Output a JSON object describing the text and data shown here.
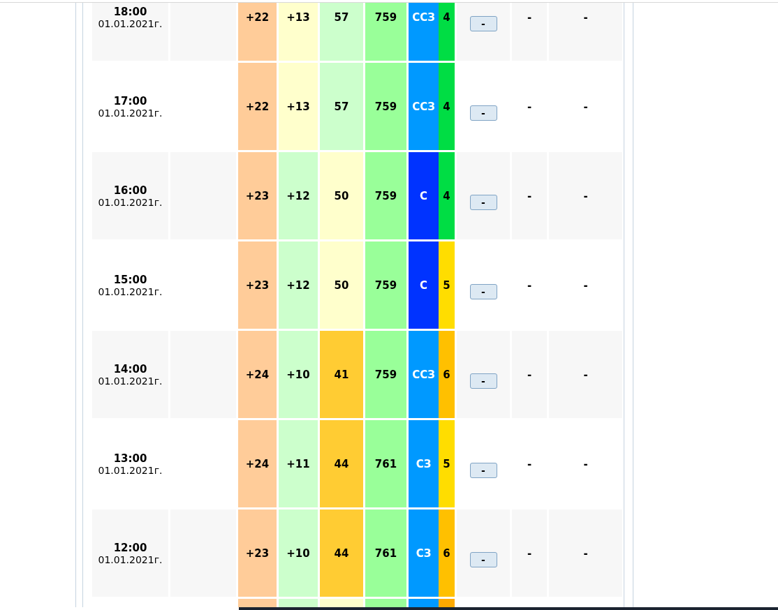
{
  "rows": [
    {
      "time": "18:00",
      "date": "01.01.2021г.",
      "temp": {
        "text": "+22",
        "color": "#ffcc99"
      },
      "feels": {
        "text": "+13",
        "color": "#ffffcc"
      },
      "humidity": {
        "text": "57",
        "color": "#ccffcc"
      },
      "pressure": {
        "text": "759",
        "color": "#99ff99"
      },
      "wind_dir": {
        "text": "ССЗ",
        "color": "#0099ff"
      },
      "wind_speed": {
        "text": "4",
        "color": "#00dd44"
      },
      "button": "-",
      "column_10": "-",
      "column_11": "-"
    },
    {
      "time": "17:00",
      "date": "01.01.2021г.",
      "temp": {
        "text": "+22",
        "color": "#ffcc99"
      },
      "feels": {
        "text": "+13",
        "color": "#ffffcc"
      },
      "humidity": {
        "text": "57",
        "color": "#ccffcc"
      },
      "pressure": {
        "text": "759",
        "color": "#99ff99"
      },
      "wind_dir": {
        "text": "ССЗ",
        "color": "#0099ff"
      },
      "wind_speed": {
        "text": "4",
        "color": "#00dd44"
      },
      "button": "-",
      "column_10": "-",
      "column_11": "-"
    },
    {
      "time": "16:00",
      "date": "01.01.2021г.",
      "temp": {
        "text": "+23",
        "color": "#ffcc99"
      },
      "feels": {
        "text": "+12",
        "color": "#ccffcc"
      },
      "humidity": {
        "text": "50",
        "color": "#ffffcc"
      },
      "pressure": {
        "text": "759",
        "color": "#99ff99"
      },
      "wind_dir": {
        "text": "С",
        "color": "#0033ff"
      },
      "wind_speed": {
        "text": "4",
        "color": "#00dd44"
      },
      "button": "-",
      "column_10": "-",
      "column_11": "-"
    },
    {
      "time": "15:00",
      "date": "01.01.2021г.",
      "temp": {
        "text": "+23",
        "color": "#ffcc99"
      },
      "feels": {
        "text": "+12",
        "color": "#ccffcc"
      },
      "humidity": {
        "text": "50",
        "color": "#ffffcc"
      },
      "pressure": {
        "text": "759",
        "color": "#99ff99"
      },
      "wind_dir": {
        "text": "С",
        "color": "#0033ff"
      },
      "wind_speed": {
        "text": "5",
        "color": "#ffdd00"
      },
      "button": "-",
      "column_10": "-",
      "column_11": "-"
    },
    {
      "time": "14:00",
      "date": "01.01.2021г.",
      "temp": {
        "text": "+24",
        "color": "#ffcc99"
      },
      "feels": {
        "text": "+10",
        "color": "#ccffcc"
      },
      "humidity": {
        "text": "41",
        "color": "#ffcc33"
      },
      "pressure": {
        "text": "759",
        "color": "#99ff99"
      },
      "wind_dir": {
        "text": "ССЗ",
        "color": "#0099ff"
      },
      "wind_speed": {
        "text": "6",
        "color": "#ffc000"
      },
      "button": "-",
      "column_10": "-",
      "column_11": "-"
    },
    {
      "time": "13:00",
      "date": "01.01.2021г.",
      "temp": {
        "text": "+24",
        "color": "#ffcc99"
      },
      "feels": {
        "text": "+11",
        "color": "#ccffcc"
      },
      "humidity": {
        "text": "44",
        "color": "#ffcc33"
      },
      "pressure": {
        "text": "761",
        "color": "#99ff99"
      },
      "wind_dir": {
        "text": "СЗ",
        "color": "#0099ff"
      },
      "wind_speed": {
        "text": "5",
        "color": "#ffdd00"
      },
      "button": "-",
      "column_10": "-",
      "column_11": "-"
    },
    {
      "time": "12:00",
      "date": "01.01.2021г.",
      "temp": {
        "text": "+23",
        "color": "#ffcc99"
      },
      "feels": {
        "text": "+10",
        "color": "#ccffcc"
      },
      "humidity": {
        "text": "44",
        "color": "#ffcc33"
      },
      "pressure": {
        "text": "761",
        "color": "#99ff99"
      },
      "wind_dir": {
        "text": "СЗ",
        "color": "#0099ff"
      },
      "wind_speed": {
        "text": "6",
        "color": "#ffc000"
      },
      "button": "-",
      "column_10": "-",
      "column_11": "-"
    },
    {
      "temp": {
        "color": "#ffcc99"
      },
      "feels": {
        "color": "#ccffcc"
      },
      "humidity": {
        "color": "#ffffcc"
      },
      "pressure": {
        "color": "#99ff99"
      },
      "wind_dir": {
        "color": "#0099ff"
      },
      "wind_speed": {
        "color": "#ffaa00"
      }
    }
  ]
}
